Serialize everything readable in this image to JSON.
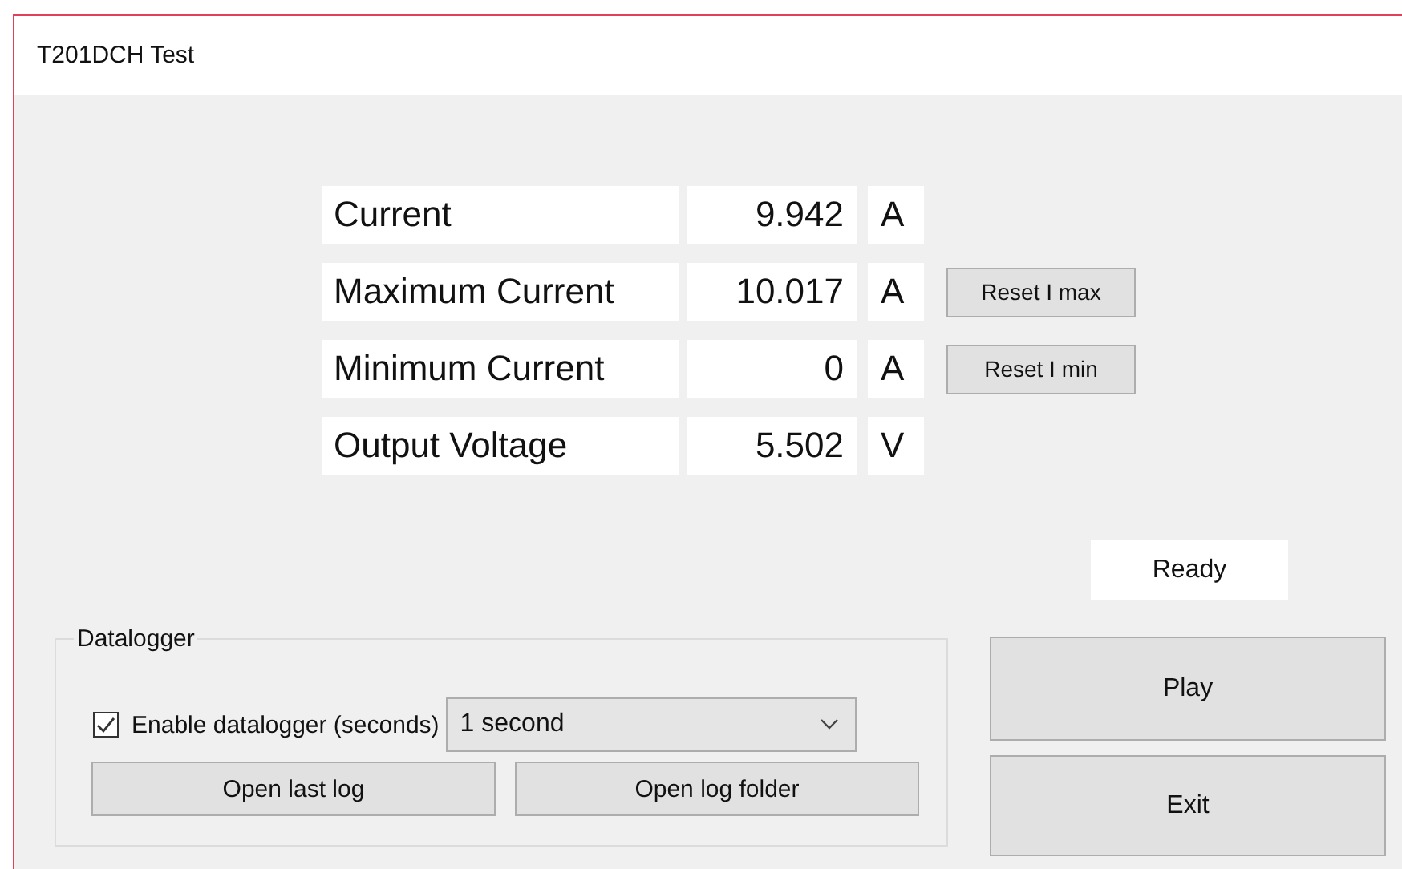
{
  "window": {
    "title": "T201DCH Test"
  },
  "readings": [
    {
      "label": "Current",
      "value": "9.942",
      "unit": "A"
    },
    {
      "label": "Maximum Current",
      "value": "10.017",
      "unit": "A",
      "button": "Reset I max"
    },
    {
      "label": "Minimum Current",
      "value": "0",
      "unit": "A",
      "button": "Reset I min"
    },
    {
      "label": "Output Voltage",
      "value": "5.502",
      "unit": "V"
    }
  ],
  "status": "Ready",
  "datalogger": {
    "title": "Datalogger",
    "enable": {
      "label": "Enable datalogger (seconds)",
      "checked": true
    },
    "interval": {
      "value": "1 second"
    },
    "buttons": [
      "Open last log",
      "Open log folder"
    ]
  },
  "buttons": [
    "Play",
    "Exit"
  ]
}
